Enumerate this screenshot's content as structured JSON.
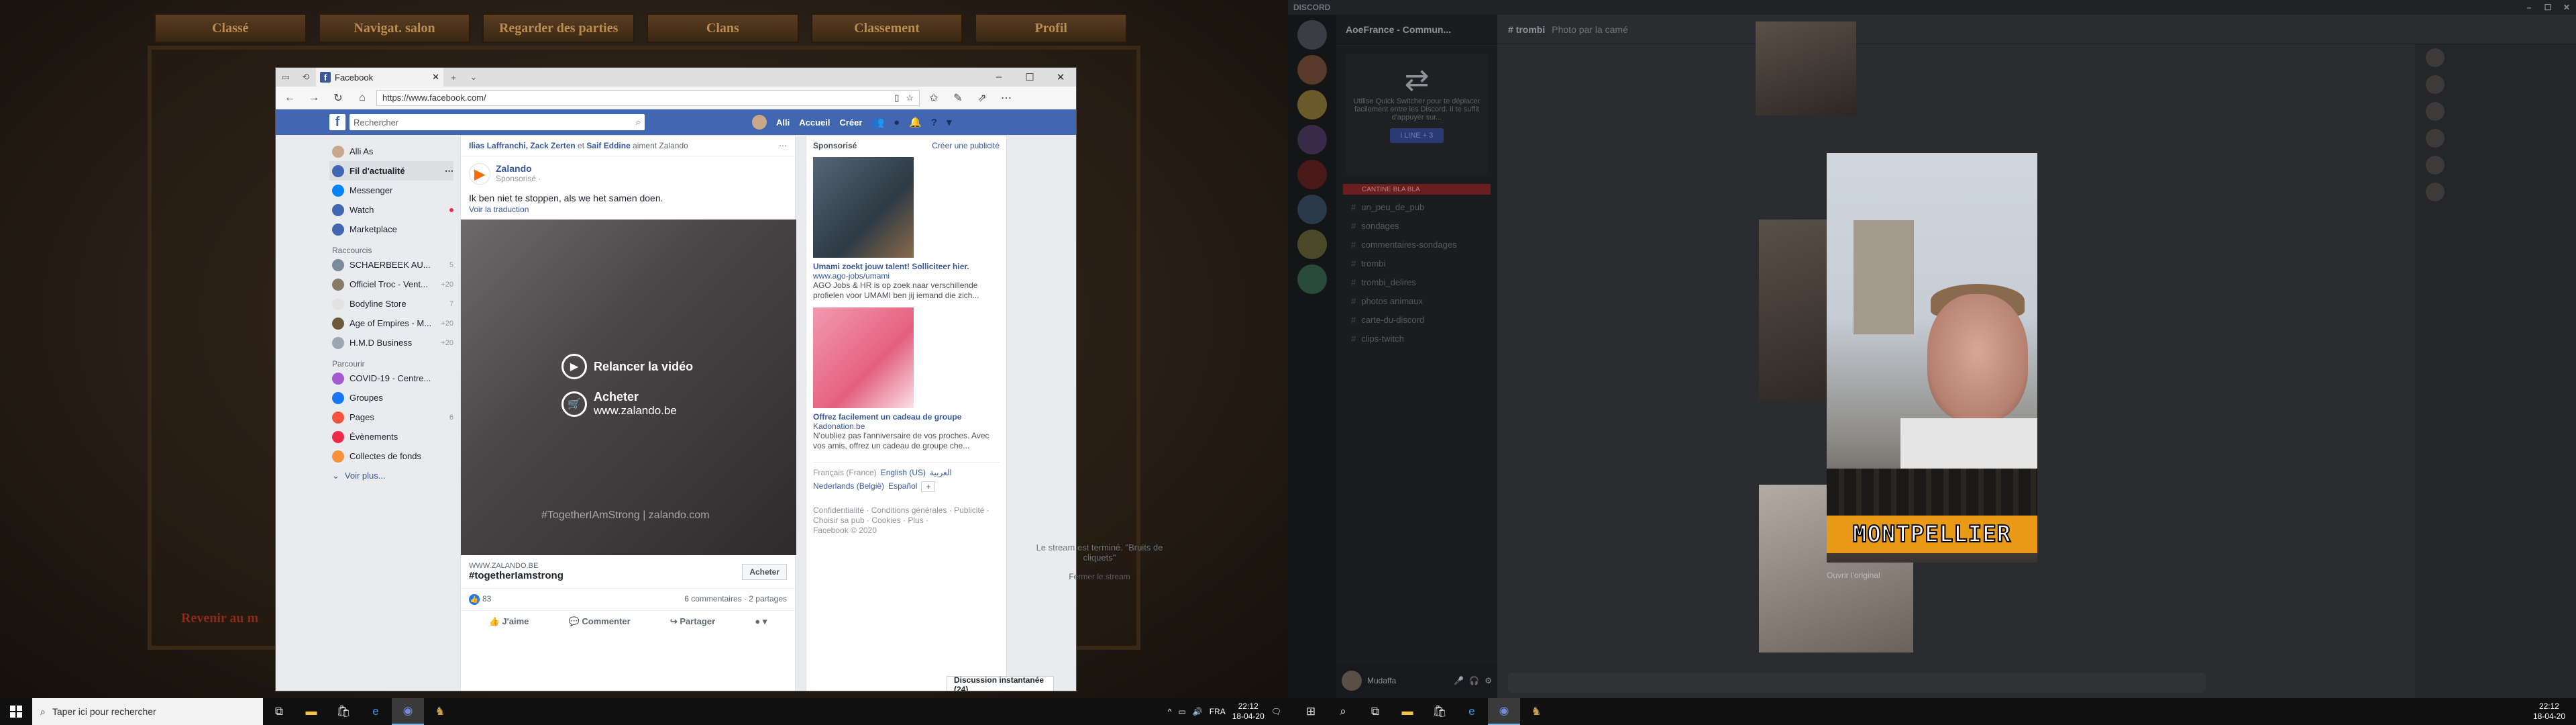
{
  "game": {
    "tabs": [
      "Classé",
      "Navigat. salon",
      "Regarder des parties",
      "Clans",
      "Classement",
      "Profil"
    ],
    "back_link": "Revenir au m"
  },
  "browser": {
    "tab_title": "Facebook",
    "url": "https://www.facebook.com/"
  },
  "facebook": {
    "search_placeholder": "Rechercher",
    "nav": {
      "user": "Alli",
      "home": "Accueil",
      "create": "Créer"
    },
    "left": {
      "profile": "Alli As",
      "items": [
        {
          "label": "Fil d'actualité",
          "color": "#4267b2"
        },
        {
          "label": "Messenger",
          "color": "#0084ff"
        },
        {
          "label": "Watch",
          "color": "#4267b2"
        },
        {
          "label": "Marketplace",
          "color": "#4267b2"
        }
      ],
      "shortcuts_title": "Raccourcis",
      "shortcuts": [
        {
          "label": "SCHAERBEEK AU...",
          "count": "5"
        },
        {
          "label": "Officiel Troc - Vent...",
          "count": "+20"
        },
        {
          "label": "Bodyline Store",
          "count": "7"
        },
        {
          "label": "Age of Empires - M...",
          "count": "+20"
        },
        {
          "label": "H.M.D Business",
          "count": "+20"
        }
      ],
      "explore_title": "Parcourir",
      "explore": [
        {
          "label": "COVID-19 - Centre...",
          "count": ""
        },
        {
          "label": "Groupes",
          "count": ""
        },
        {
          "label": "Pages",
          "count": "6"
        },
        {
          "label": "Évènements",
          "count": ""
        },
        {
          "label": "Collectes de fonds",
          "count": ""
        }
      ],
      "see_more": "Voir plus..."
    },
    "post": {
      "reactors_names": "Ilias Laffranchi, Zack Zerten",
      "reactors_and": " et ",
      "reactors_last": "Saif Eddine",
      "reactors_suffix": " aiment Zalando",
      "page": "Zalando",
      "sponsored": "Sponsorisé ·",
      "text": "Ik ben niet te stoppen, als we het samen doen.",
      "translate": "Voir la traduction",
      "cta_replay": "Relancer la vidéo",
      "cta_buy": "Acheter",
      "cta_site": "www.zalando.be",
      "watermark": "#TogetherIAmStrong | zalando.com",
      "link_domain": "WWW.ZALANDO.BE",
      "link_title": "#togetherIamstrong",
      "buy_button": "Acheter",
      "likes": "83",
      "comments_shares": "6 commentaires · 2 partages",
      "actions": {
        "like": "J'aime",
        "comment": "Commenter",
        "share": "Partager"
      }
    },
    "right": {
      "sponsored_title": "Sponsorisé",
      "create_ad": "Créer une publicité",
      "ads": [
        {
          "title": "Umami zoekt jouw talent! Solliciteer hier.",
          "url": "www.ago-jobs/umami",
          "body": "AGO Jobs & HR is op zoek naar verschillende profielen voor UMAMI ben jij iemand die zich..."
        },
        {
          "title": "Offrez facilement un cadeau de groupe",
          "url": "Kadonation.be",
          "body": "N'oubliez pas l'anniversaire de vos proches. Avec vos amis, offrez un cadeau de groupe che..."
        }
      ],
      "lang_current": "Français (France)",
      "langs": [
        "English (US)",
        "العربية",
        "Nederlands (België)",
        "Español"
      ],
      "footer": "Confidentialité · Conditions générales · Publicité · Choisir sa pub · Cookies · Plus ·",
      "copyright": "Facebook © 2020"
    },
    "chat_tab": "Discussion instantanée (24)"
  },
  "taskbar_left": {
    "search_placeholder": "Taper ici pour rechercher",
    "lang": "FRA",
    "time": "22:12",
    "date": "18-04-20"
  },
  "discord": {
    "brand": "DISCORD",
    "server": "AoeFrance - Commun...",
    "header_channel": "# trombi",
    "header_desc": "Photo par la camé",
    "invite_btn": "i LINE + 3",
    "invite_text": "Utilise Quick Switcher pour te déplacer facilement entre les Discord. Il te suffit d'appuyer sur...",
    "category": "CANTINE BLA BLA",
    "channels": [
      "un_peu_de_pub",
      "sondages",
      "commentaires-sondages",
      "trombi",
      "trombi_delires",
      "photos animaux",
      "carte-du-discord",
      "clips-twitch"
    ],
    "user": "Mudaffa",
    "ended_text": "Le stream est terminé. \"Bruits de cliquets\"",
    "ended_btn": "Fermer le stream",
    "open_original": "Ouvrir l'original",
    "photo_banner": "MONTPELLIER",
    "time": "22:12",
    "date": "18-04-20"
  }
}
